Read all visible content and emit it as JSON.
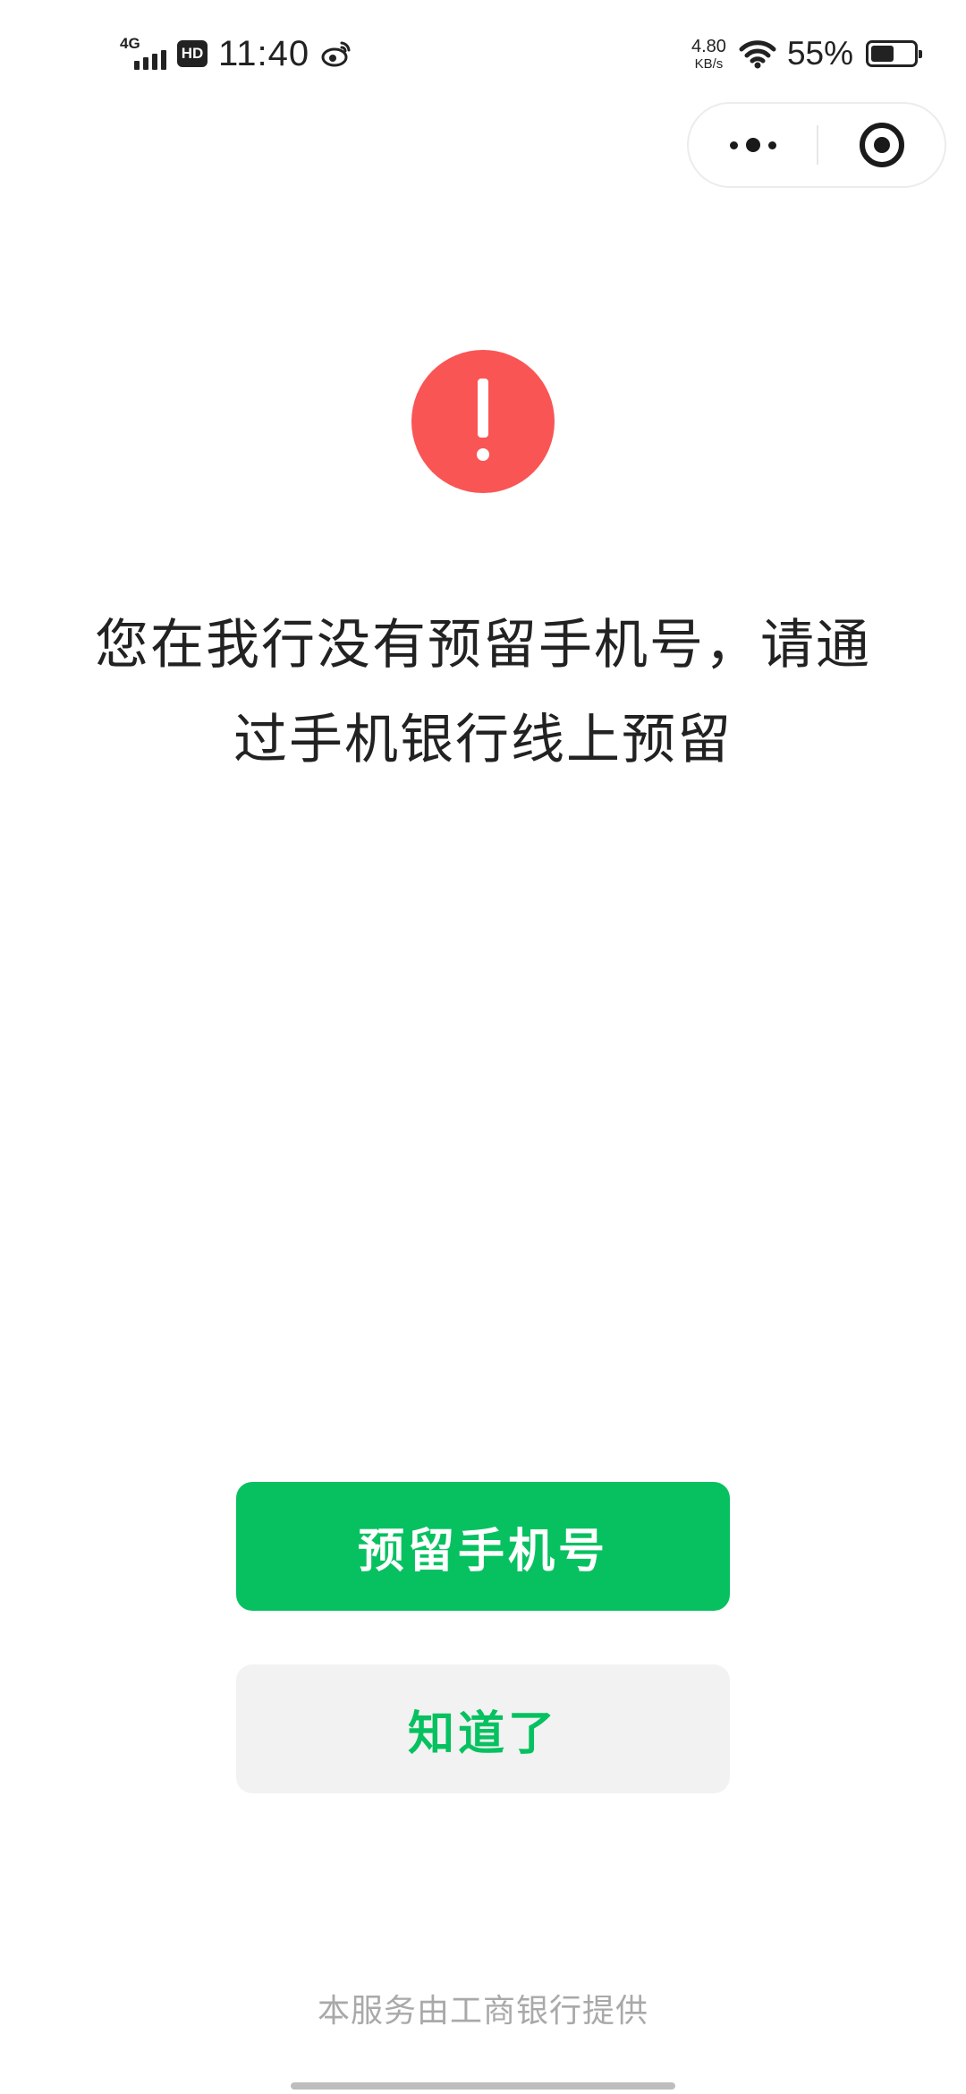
{
  "status_bar": {
    "network_type": "4G",
    "signal_icon": "signal-bars-icon",
    "hd_badge": "HD",
    "time": "11:40",
    "notification_icon": "weibo-icon",
    "net_speed_value": "4.80",
    "net_speed_unit": "KB/s",
    "wifi_icon": "wifi-icon",
    "battery_percent": "55%",
    "battery_level": 0.55
  },
  "capsule": {
    "more_icon": "more-dots-icon",
    "close_icon": "target-close-icon"
  },
  "alert": {
    "icon": "exclamation-icon",
    "icon_color": "#f95555",
    "message_line1": "您在我行没有预留手机号，请通",
    "message_line2": "过手机银行线上预留"
  },
  "actions": {
    "primary_label": "预留手机号",
    "secondary_label": "知道了",
    "accent_color": "#07c160"
  },
  "footer": {
    "provider_text": "本服务由工商银行提供"
  }
}
